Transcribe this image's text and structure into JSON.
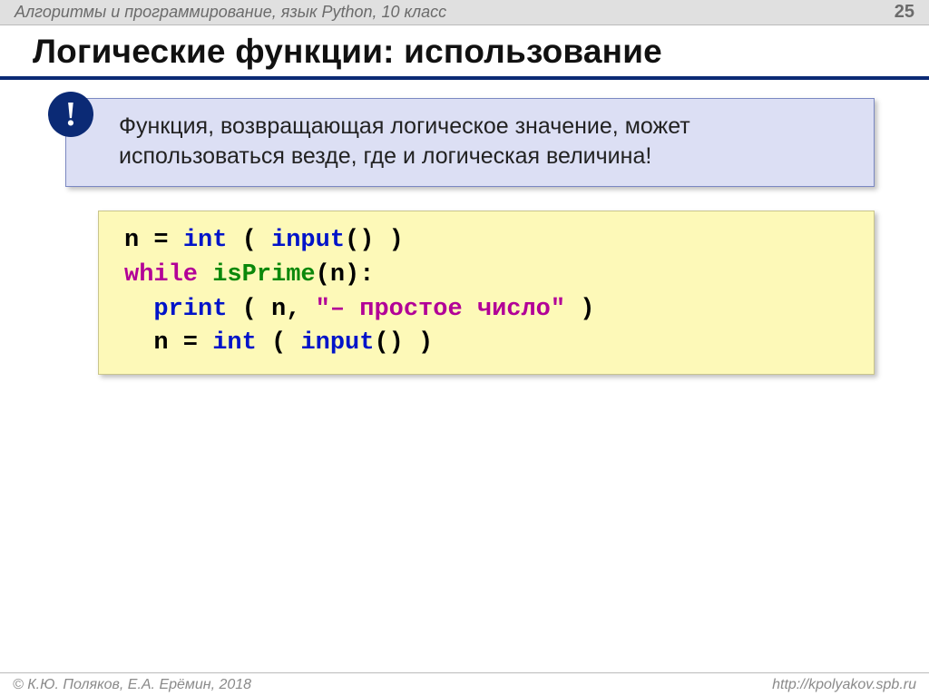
{
  "header": {
    "course": "Алгоритмы и программирование, язык Python, 10 класс",
    "page": "25"
  },
  "title": "Логические функции: использование",
  "note": {
    "badge": "!",
    "text": "Функция, возвращающая логическое значение, может использоваться везде, где и логическая величина!"
  },
  "code": {
    "tokens": [
      {
        "t": "n",
        "c": ""
      },
      {
        "t": " = ",
        "c": ""
      },
      {
        "t": "int",
        "c": "kw"
      },
      {
        "t": " ( ",
        "c": ""
      },
      {
        "t": "input",
        "c": "kw"
      },
      {
        "t": "() )",
        "c": ""
      },
      {
        "t": "\n",
        "c": ""
      },
      {
        "t": "while",
        "c": "ctrl"
      },
      {
        "t": " ",
        "c": ""
      },
      {
        "t": "isPrime",
        "c": "fn"
      },
      {
        "t": "(n):",
        "c": ""
      },
      {
        "t": "\n",
        "c": ""
      },
      {
        "t": "  ",
        "c": ""
      },
      {
        "t": "print",
        "c": "kw"
      },
      {
        "t": " ( n, ",
        "c": ""
      },
      {
        "t": "\"– простое число\"",
        "c": "str"
      },
      {
        "t": " )",
        "c": ""
      },
      {
        "t": "\n",
        "c": ""
      },
      {
        "t": "  n = ",
        "c": ""
      },
      {
        "t": "int",
        "c": "kw"
      },
      {
        "t": " ( ",
        "c": ""
      },
      {
        "t": "input",
        "c": "kw"
      },
      {
        "t": "() )",
        "c": ""
      }
    ]
  },
  "footer": {
    "left": "© К.Ю. Поляков, Е.А. Ерёмин, 2018",
    "right": "http://kpolyakov.spb.ru"
  }
}
